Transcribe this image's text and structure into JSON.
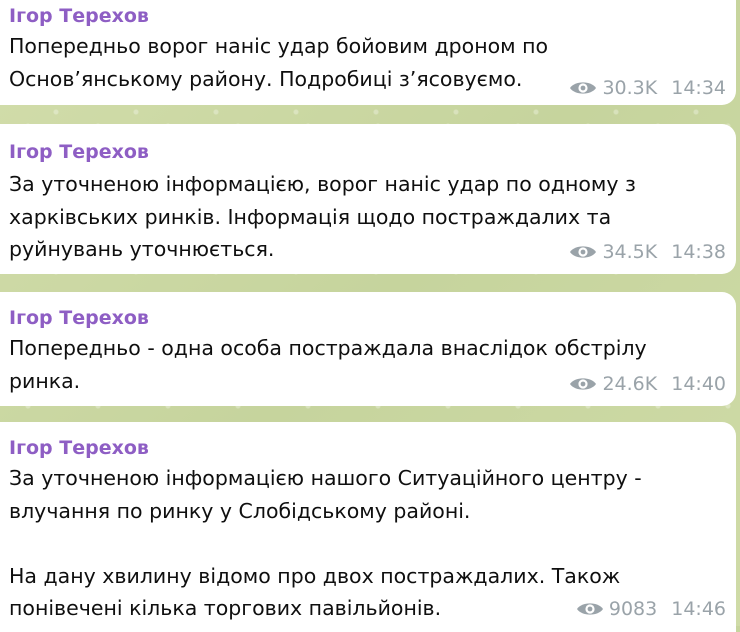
{
  "messages": [
    {
      "author": "Ігор Терехов",
      "text": "Попередньо ворог наніс удар бойовим дроном по\nОснов’янському району. Подробиці з’ясовуємо.",
      "views": "30.3K",
      "time": "14:34",
      "views_icon": "eye-icon"
    },
    {
      "author": "Ігор Терехов",
      "text": "За уточненою інформацією, ворог наніс удар по одному з\nхарківських ринків. Інформація щодо постраждалих та\nруйнувань уточнюється.",
      "views": "34.5K",
      "time": "14:38",
      "views_icon": "eye-icon"
    },
    {
      "author": "Ігор Терехов",
      "text": "Попередньо - одна особа постраждала внаслідок обстрілу\nринка.",
      "views": "24.6K",
      "time": "14:40",
      "views_icon": "eye-icon"
    },
    {
      "author": "Ігор Терехов",
      "text": "За уточненою інформацією нашого Ситуаційного центру -\nвлучання по ринку у Слобідському районі.\n\nНа дану хвилину відомо про двох постраждалих. Також\nпонівечені кілька торгових павільйонів.",
      "views": "9083",
      "time": "14:46",
      "views_icon": "eye-icon"
    }
  ],
  "colors": {
    "author": "#8e5ec4",
    "text": "#0f0f0f",
    "meta": "#9aa3a9",
    "bubble": "#ffffff",
    "background": "#cbd8a4"
  }
}
